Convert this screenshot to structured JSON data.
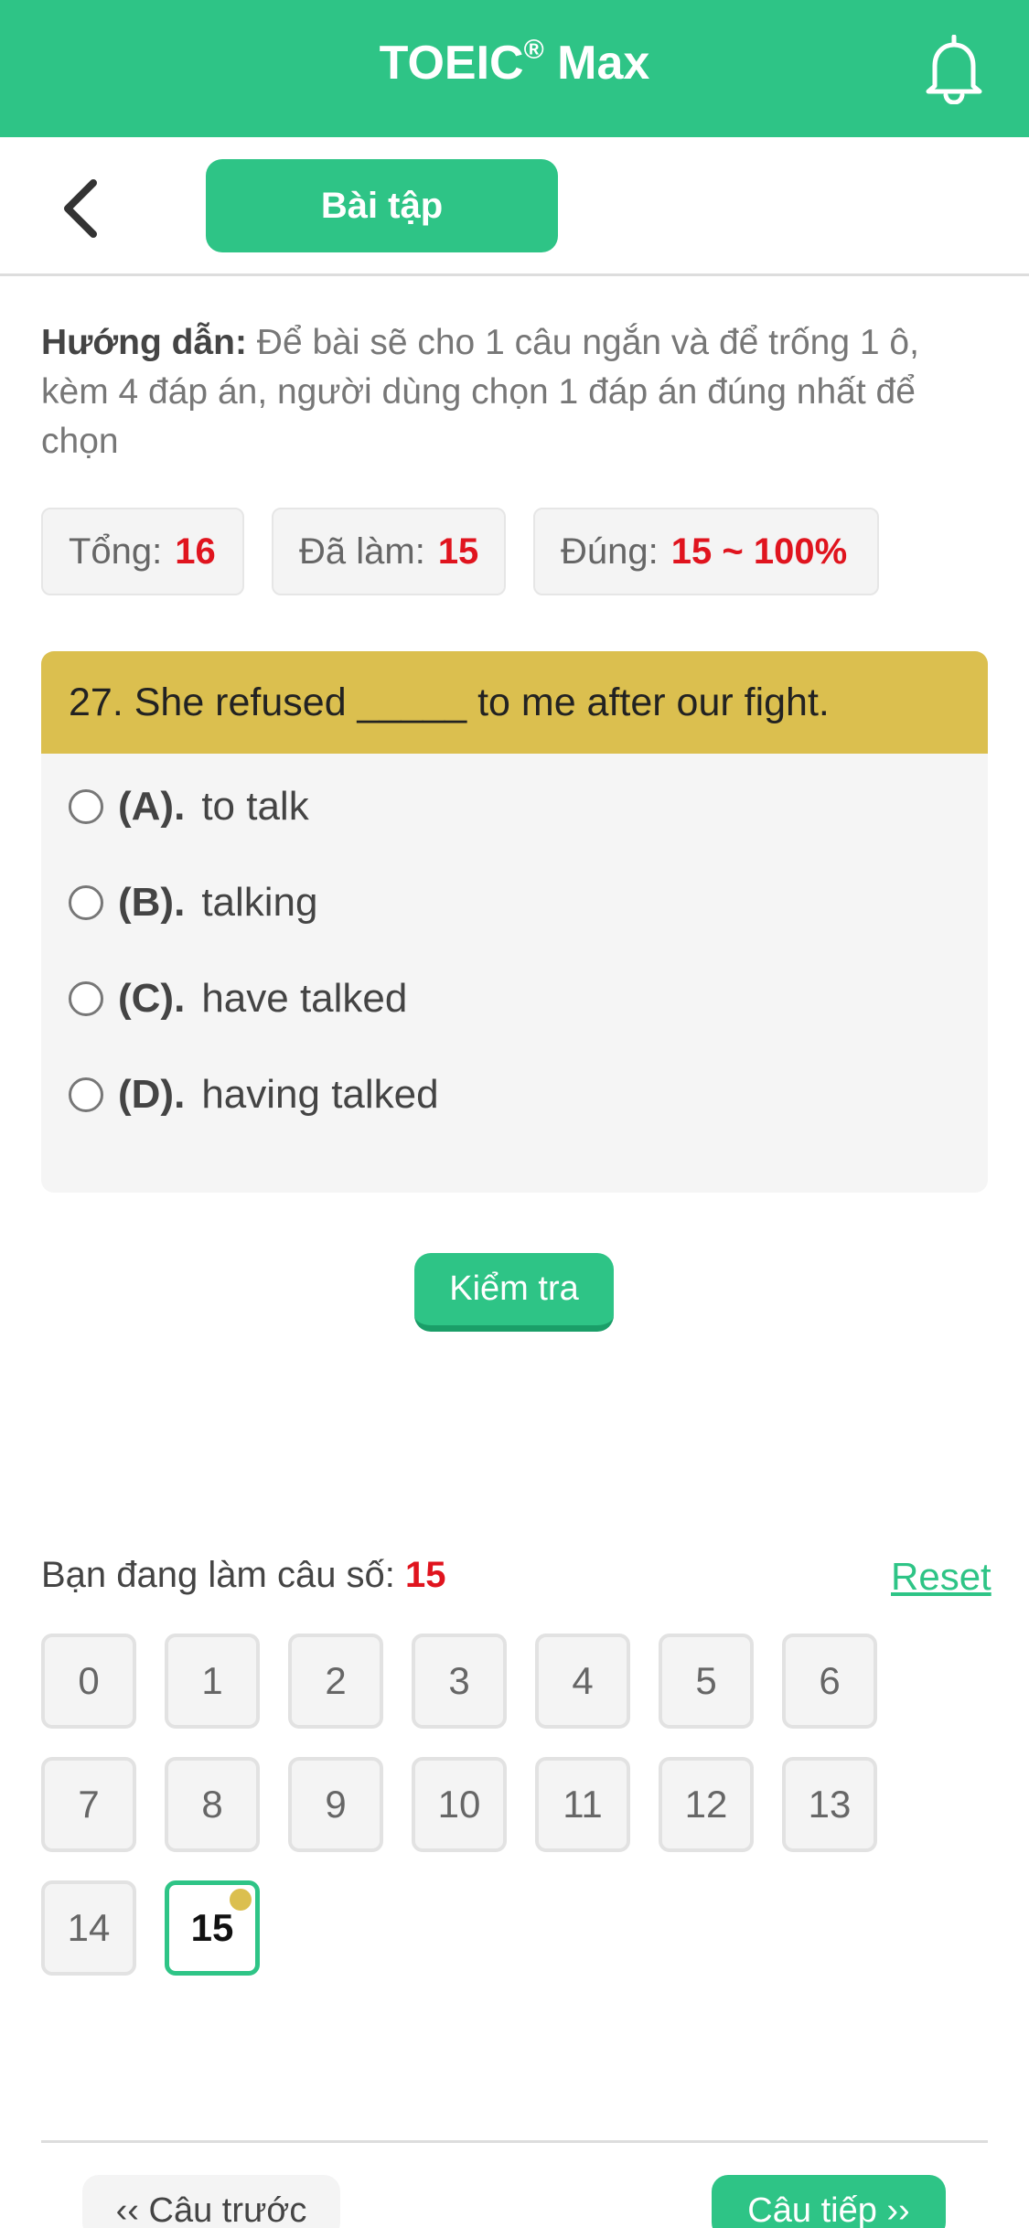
{
  "app": {
    "title": "TOEIC",
    "title_mark": "®",
    "title_suffix": " Max",
    "brand_color": "#2ec486",
    "bell_icon": "bell-icon"
  },
  "subbar": {
    "back_icon": "chevron-left-icon",
    "tab_label": "Bài tập"
  },
  "instructions": {
    "label": "Hướng dẫn:",
    "text": " Để bài sẽ cho 1 câu ngắn và để trống 1 ô, kèm 4 đáp án, người dùng chọn 1 đáp án đúng nhất để chọn"
  },
  "stats": {
    "total_label": "Tổng:",
    "total_value": "16",
    "done_label": "Đã làm:",
    "done_value": "15",
    "correct_label": "Đúng:",
    "correct_value": "15 ~ 100%"
  },
  "question": {
    "text": "27. She refused _____ to me after our fight.",
    "header_color": "#dbbf4f",
    "options": [
      {
        "letter": "(A).",
        "text": "to talk"
      },
      {
        "letter": "(B).",
        "text": "talking"
      },
      {
        "letter": "(C).",
        "text": "have talked"
      },
      {
        "letter": "(D).",
        "text": "having talked"
      }
    ]
  },
  "check_button": "Kiểm tra",
  "progress": {
    "label": "Bạn đang làm câu số: ",
    "current": "15",
    "reset_label": "Reset"
  },
  "question_numbers": [
    "0",
    "1",
    "2",
    "3",
    "4",
    "5",
    "6",
    "7",
    "8",
    "9",
    "10",
    "11",
    "12",
    "13",
    "14",
    "15"
  ],
  "current_index": 15,
  "nav": {
    "prev_label": "‹‹ Câu trước",
    "next_label": "Câu tiếp ››"
  }
}
